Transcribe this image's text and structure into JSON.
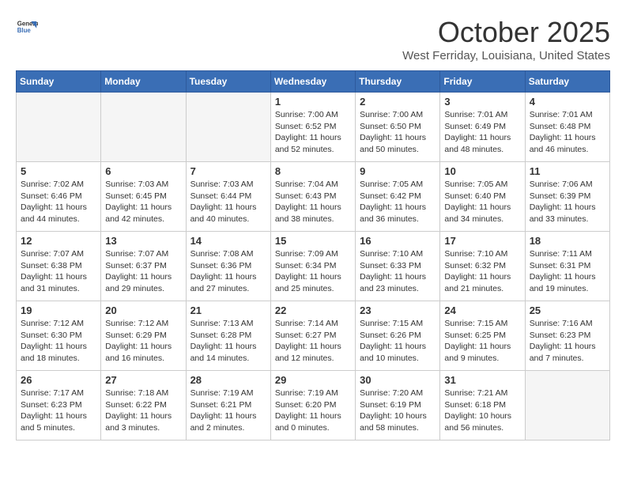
{
  "header": {
    "logo_general": "General",
    "logo_blue": "Blue",
    "month": "October 2025",
    "location": "West Ferriday, Louisiana, United States"
  },
  "days_of_week": [
    "Sunday",
    "Monday",
    "Tuesday",
    "Wednesday",
    "Thursday",
    "Friday",
    "Saturday"
  ],
  "weeks": [
    [
      {
        "day": "",
        "empty": true
      },
      {
        "day": "",
        "empty": true
      },
      {
        "day": "",
        "empty": true
      },
      {
        "day": "1",
        "sunrise": "7:00 AM",
        "sunset": "6:52 PM",
        "daylight": "11 hours and 52 minutes."
      },
      {
        "day": "2",
        "sunrise": "7:00 AM",
        "sunset": "6:50 PM",
        "daylight": "11 hours and 50 minutes."
      },
      {
        "day": "3",
        "sunrise": "7:01 AM",
        "sunset": "6:49 PM",
        "daylight": "11 hours and 48 minutes."
      },
      {
        "day": "4",
        "sunrise": "7:01 AM",
        "sunset": "6:48 PM",
        "daylight": "11 hours and 46 minutes."
      }
    ],
    [
      {
        "day": "5",
        "sunrise": "7:02 AM",
        "sunset": "6:46 PM",
        "daylight": "11 hours and 44 minutes."
      },
      {
        "day": "6",
        "sunrise": "7:03 AM",
        "sunset": "6:45 PM",
        "daylight": "11 hours and 42 minutes."
      },
      {
        "day": "7",
        "sunrise": "7:03 AM",
        "sunset": "6:44 PM",
        "daylight": "11 hours and 40 minutes."
      },
      {
        "day": "8",
        "sunrise": "7:04 AM",
        "sunset": "6:43 PM",
        "daylight": "11 hours and 38 minutes."
      },
      {
        "day": "9",
        "sunrise": "7:05 AM",
        "sunset": "6:42 PM",
        "daylight": "11 hours and 36 minutes."
      },
      {
        "day": "10",
        "sunrise": "7:05 AM",
        "sunset": "6:40 PM",
        "daylight": "11 hours and 34 minutes."
      },
      {
        "day": "11",
        "sunrise": "7:06 AM",
        "sunset": "6:39 PM",
        "daylight": "11 hours and 33 minutes."
      }
    ],
    [
      {
        "day": "12",
        "sunrise": "7:07 AM",
        "sunset": "6:38 PM",
        "daylight": "11 hours and 31 minutes."
      },
      {
        "day": "13",
        "sunrise": "7:07 AM",
        "sunset": "6:37 PM",
        "daylight": "11 hours and 29 minutes."
      },
      {
        "day": "14",
        "sunrise": "7:08 AM",
        "sunset": "6:36 PM",
        "daylight": "11 hours and 27 minutes."
      },
      {
        "day": "15",
        "sunrise": "7:09 AM",
        "sunset": "6:34 PM",
        "daylight": "11 hours and 25 minutes."
      },
      {
        "day": "16",
        "sunrise": "7:10 AM",
        "sunset": "6:33 PM",
        "daylight": "11 hours and 23 minutes."
      },
      {
        "day": "17",
        "sunrise": "7:10 AM",
        "sunset": "6:32 PM",
        "daylight": "11 hours and 21 minutes."
      },
      {
        "day": "18",
        "sunrise": "7:11 AM",
        "sunset": "6:31 PM",
        "daylight": "11 hours and 19 minutes."
      }
    ],
    [
      {
        "day": "19",
        "sunrise": "7:12 AM",
        "sunset": "6:30 PM",
        "daylight": "11 hours and 18 minutes."
      },
      {
        "day": "20",
        "sunrise": "7:12 AM",
        "sunset": "6:29 PM",
        "daylight": "11 hours and 16 minutes."
      },
      {
        "day": "21",
        "sunrise": "7:13 AM",
        "sunset": "6:28 PM",
        "daylight": "11 hours and 14 minutes."
      },
      {
        "day": "22",
        "sunrise": "7:14 AM",
        "sunset": "6:27 PM",
        "daylight": "11 hours and 12 minutes."
      },
      {
        "day": "23",
        "sunrise": "7:15 AM",
        "sunset": "6:26 PM",
        "daylight": "11 hours and 10 minutes."
      },
      {
        "day": "24",
        "sunrise": "7:15 AM",
        "sunset": "6:25 PM",
        "daylight": "11 hours and 9 minutes."
      },
      {
        "day": "25",
        "sunrise": "7:16 AM",
        "sunset": "6:23 PM",
        "daylight": "11 hours and 7 minutes."
      }
    ],
    [
      {
        "day": "26",
        "sunrise": "7:17 AM",
        "sunset": "6:23 PM",
        "daylight": "11 hours and 5 minutes."
      },
      {
        "day": "27",
        "sunrise": "7:18 AM",
        "sunset": "6:22 PM",
        "daylight": "11 hours and 3 minutes."
      },
      {
        "day": "28",
        "sunrise": "7:19 AM",
        "sunset": "6:21 PM",
        "daylight": "11 hours and 2 minutes."
      },
      {
        "day": "29",
        "sunrise": "7:19 AM",
        "sunset": "6:20 PM",
        "daylight": "11 hours and 0 minutes."
      },
      {
        "day": "30",
        "sunrise": "7:20 AM",
        "sunset": "6:19 PM",
        "daylight": "10 hours and 58 minutes."
      },
      {
        "day": "31",
        "sunrise": "7:21 AM",
        "sunset": "6:18 PM",
        "daylight": "10 hours and 56 minutes."
      },
      {
        "day": "",
        "empty": true
      }
    ]
  ],
  "labels": {
    "sunrise": "Sunrise:",
    "sunset": "Sunset:",
    "daylight": "Daylight:"
  }
}
